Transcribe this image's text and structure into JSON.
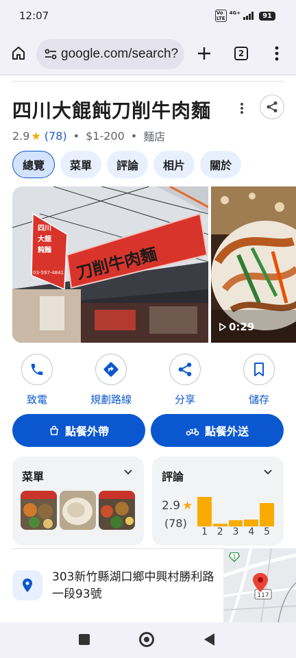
{
  "status_bar": {
    "time": "12:07",
    "volte": "Vo LTE",
    "network": "4G+",
    "battery": "91"
  },
  "browser": {
    "url": "google.com/search?",
    "tab_count": "2"
  },
  "place": {
    "name": "四川大餛飩刀削牛肉麵",
    "rating": "2.9",
    "review_count": "(78)",
    "price": "$1-200",
    "category": "麵店",
    "separator": "•"
  },
  "chips": [
    {
      "label": "總覽",
      "active": true
    },
    {
      "label": "菜單"
    },
    {
      "label": "評論"
    },
    {
      "label": "相片"
    },
    {
      "label": "關於"
    }
  ],
  "photos": {
    "video_duration": "0:29",
    "sign_text": "刀削牛肉麵",
    "side_sign_text": "四川大餛飩刀削牛肉麵",
    "phone_on_sign": "03-597-4841"
  },
  "actions": [
    {
      "label": "致電",
      "icon": "phone-icon"
    },
    {
      "label": "規劃路線",
      "icon": "directions-icon"
    },
    {
      "label": "分享",
      "icon": "share-icon"
    },
    {
      "label": "儲存",
      "icon": "bookmark-icon"
    }
  ],
  "order_buttons": {
    "takeout": "點餐外帶",
    "delivery": "點餐外送"
  },
  "menu_card": {
    "title": "菜單"
  },
  "reviews_card": {
    "title": "評論",
    "rating": "2.9",
    "count": "(78)",
    "histogram": [
      {
        "label": "1",
        "fraction": 0.86
      },
      {
        "label": "2",
        "fraction": 0.08
      },
      {
        "label": "3",
        "fraction": 0.18
      },
      {
        "label": "4",
        "fraction": 0.2
      },
      {
        "label": "5",
        "fraction": 0.68
      }
    ]
  },
  "address": {
    "text": "303新竹縣湖口鄉中興村勝利路一段93號",
    "map_route_1": "1",
    "map_route_117": "117"
  },
  "colors": {
    "accent": "#0b57d0",
    "star": "#f9ab00",
    "chip_bg": "#e8f0fe",
    "sign_red": "#d9342b"
  }
}
